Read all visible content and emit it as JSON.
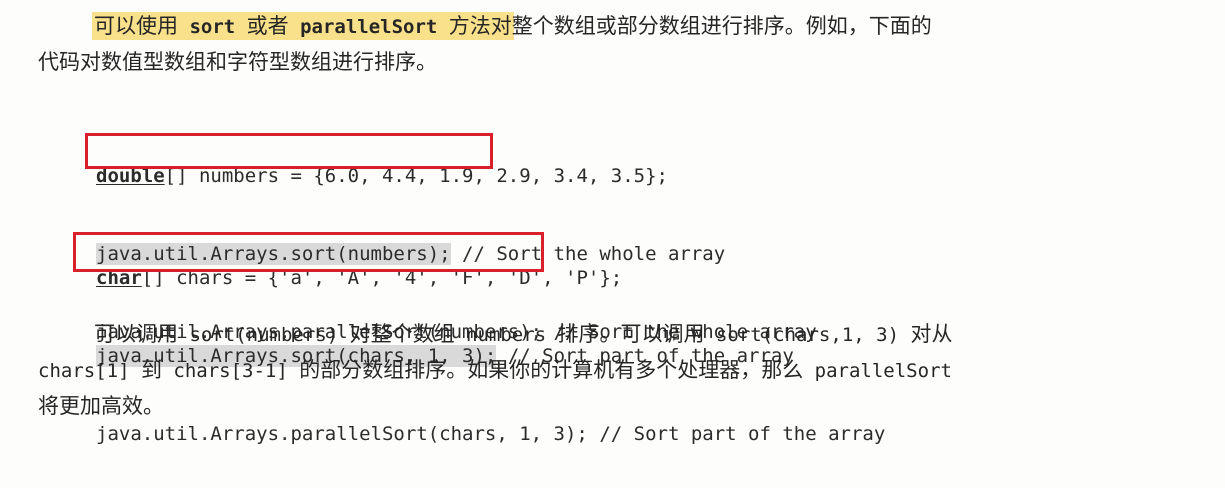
{
  "paragraph1": {
    "line1_highlight_a": "可以使用",
    "line1_code_sort": " sort ",
    "line1_highlight_b": "或者",
    "line1_code_parallel": " parallelSort ",
    "line1_highlight_c": "方法对",
    "line1_rest": "整个数组或部分数组进行排序。例如，下面的",
    "line2": "代码对数值型数组和字符型数组进行排序。"
  },
  "code_block_1": {
    "decl_type": "double",
    "decl_rest": "[] numbers = {6.0, 4.4, 1.9, 2.9, 3.4, 3.5};",
    "sort_call": "java.util.Arrays.sort(numbers);",
    "sort_comment": " // Sort the whole array",
    "parallel_line": "java.util.Arrays.parallelSort(numbers); // Sort the whole array"
  },
  "code_block_2": {
    "decl_type": "char",
    "decl_rest": "[] chars = {'a', 'A', '4', 'F', 'D', 'P'};",
    "sort_call": "java.util.Arrays.sort(chars, 1, 3);",
    "sort_comment": " // Sort part of the array",
    "parallel_line": "java.util.Arrays.parallelSort(chars, 1, 3); // Sort part of the array"
  },
  "paragraph2": {
    "l1_a": "可以调用",
    "l1_code_a": " sort(numbers) ",
    "l1_b": "对整个数组",
    "l1_code_b": " numbers ",
    "l1_c": "排序。可以调用",
    "l1_code_c": " sort(chars,1, 3) ",
    "l1_d": "对从",
    "l2_code_a": "chars[1] ",
    "l2_a": "到",
    "l2_code_b": " chars[3-1] ",
    "l2_b": "的部分数组排序。如果你的计算机有多个处理器，那么",
    "l2_code_c": " parallelSort",
    "l3": "将更加高效。"
  },
  "colors": {
    "highlight": "#f9e08a",
    "annotation_box": "#d9202a",
    "code_shade": "#d9d9d9"
  }
}
